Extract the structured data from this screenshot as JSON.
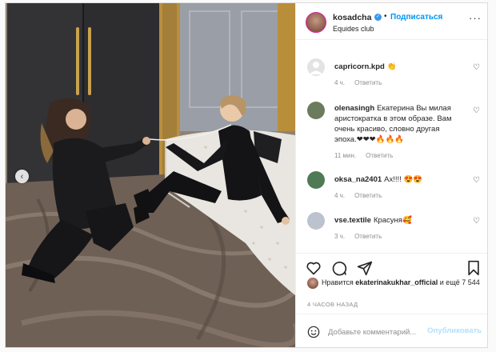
{
  "post": {
    "username": "kosadcha",
    "verified_icon": "verified-check-icon",
    "dot": "•",
    "follow_label": "Подписаться",
    "location": "Equides club",
    "more_icon": "more-dots-icon"
  },
  "photo": {
    "prev_icon": "chevron-left-icon",
    "prev_glyph": "‹"
  },
  "comments": [
    {
      "username": "capricorn.kpd",
      "text": "👏",
      "time": "4 ч.",
      "reply": "Ответить",
      "avatar_color": "#e0e0e0"
    },
    {
      "username": "olenasingh",
      "text": "Екатерина Вы милая аристократка в этом образе. Вам очень красиво, словно другая эпоха.❤❤❤🔥🔥🔥",
      "time": "11 мин.",
      "reply": "Ответить",
      "avatar_color": "#6b7b5e"
    },
    {
      "username": "oksa_na2401",
      "text": "Ах!!!! 😍😍",
      "time": "4 ч.",
      "reply": "Ответить",
      "avatar_color": "#4f7a55"
    },
    {
      "username": "vse.textile",
      "text": "Красуня🥰",
      "time": "3 ч.",
      "reply": "Ответить",
      "avatar_color": "#bcc3cf"
    }
  ],
  "actions": {
    "like_icon": "heart-icon",
    "comment_icon": "comment-bubble-icon",
    "share_icon": "paper-plane-icon",
    "save_icon": "bookmark-icon"
  },
  "likes": {
    "prefix": "Нравится ",
    "user": "ekaterinakukhar_official",
    "suffix": " и ещё 7 544"
  },
  "time_ago": "4 ЧАСОВ НАЗАД",
  "add_comment": {
    "emoji_icon": "smiley-icon",
    "placeholder": "Добавьте комментарий...",
    "publish_label": "Опубликовать"
  },
  "colors": {
    "accent": "#0095f6",
    "publish_disabled": "#b2dffc",
    "muted": "#8e8e8e"
  }
}
